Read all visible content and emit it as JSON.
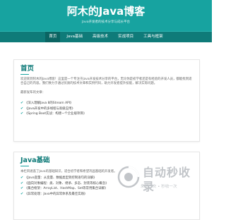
{
  "header": {
    "title": "阿木的Java博客",
    "subtitle": "Java开发者的技术分享与成长平台"
  },
  "nav": {
    "items": [
      "首页",
      "Java基础",
      "高级技术",
      "实战项目",
      "工具与框架"
    ]
  },
  "home": {
    "title": "首页",
    "intro": "欢迎来到阿木的Java博客！这里是一个专注于Java开发技术分享的平台，无论你是初学者还是有经验的开发人员，都能找到适合自己的内容。我们致力于通过优质的技术文章和实例代码，助力开发者提升技能，解决实际问题。",
    "recent_label": "最新发布的文章：",
    "articles": [
      "《深入理解Java 8的Stream API》",
      "《Java开发中的多线程与高级应用》",
      "《Spring Boot实战：构建一个企业级项目》"
    ]
  },
  "java_basics": {
    "title": "Java基础",
    "intro": "本栏目涵盖了Java的基础知识，适合初学者和希望巩固基础的开发者。",
    "items": [
      "《Java变量：从变量、数据类型到控制语句的详解》",
      "《面向对象编程：类、对象、继承、多态、封装等核心概念》",
      "《集合框架：ArrayList、HashMap、Set等常用集合详解》",
      "《异常处理：Java中的异常体系及最佳实践》"
    ]
  },
  "watermark": {
    "text": "自动秒收录",
    "tagline": "来访一次 • 秒收一次"
  }
}
